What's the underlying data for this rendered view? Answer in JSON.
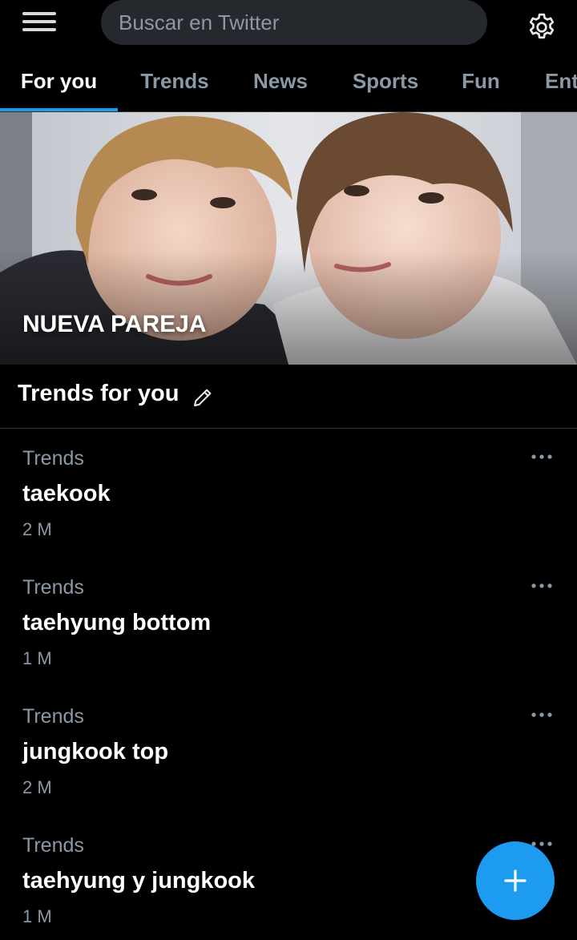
{
  "search": {
    "placeholder": "Buscar en Twitter"
  },
  "tabs": [
    {
      "label": "For you",
      "active": true
    },
    {
      "label": "Trends"
    },
    {
      "label": "News"
    },
    {
      "label": "Sports"
    },
    {
      "label": "Fun"
    },
    {
      "label": "Ent"
    }
  ],
  "hero": {
    "title": "NUEVA PAREJA"
  },
  "section": {
    "title": "Trends for you"
  },
  "trends": [
    {
      "context": "Trends",
      "name": "taekook",
      "count": "2 M"
    },
    {
      "context": "Trends",
      "name": "taehyung bottom",
      "count": "1 M"
    },
    {
      "context": "Trends",
      "name": "jungkook top",
      "count": "2 M"
    },
    {
      "context": "Trends",
      "name": "taehyung y jungkook",
      "count": "1 M"
    }
  ],
  "colors": {
    "background": "#000000",
    "accent": "#1d9bf0",
    "secondary_text": "#8b98a5",
    "search_bg": "#25282c"
  },
  "icons": {
    "menu": "hamburger-menu-icon",
    "settings": "gear-icon",
    "edit": "pencil-icon",
    "more": "more-dots-icon",
    "compose": "plus-icon"
  }
}
